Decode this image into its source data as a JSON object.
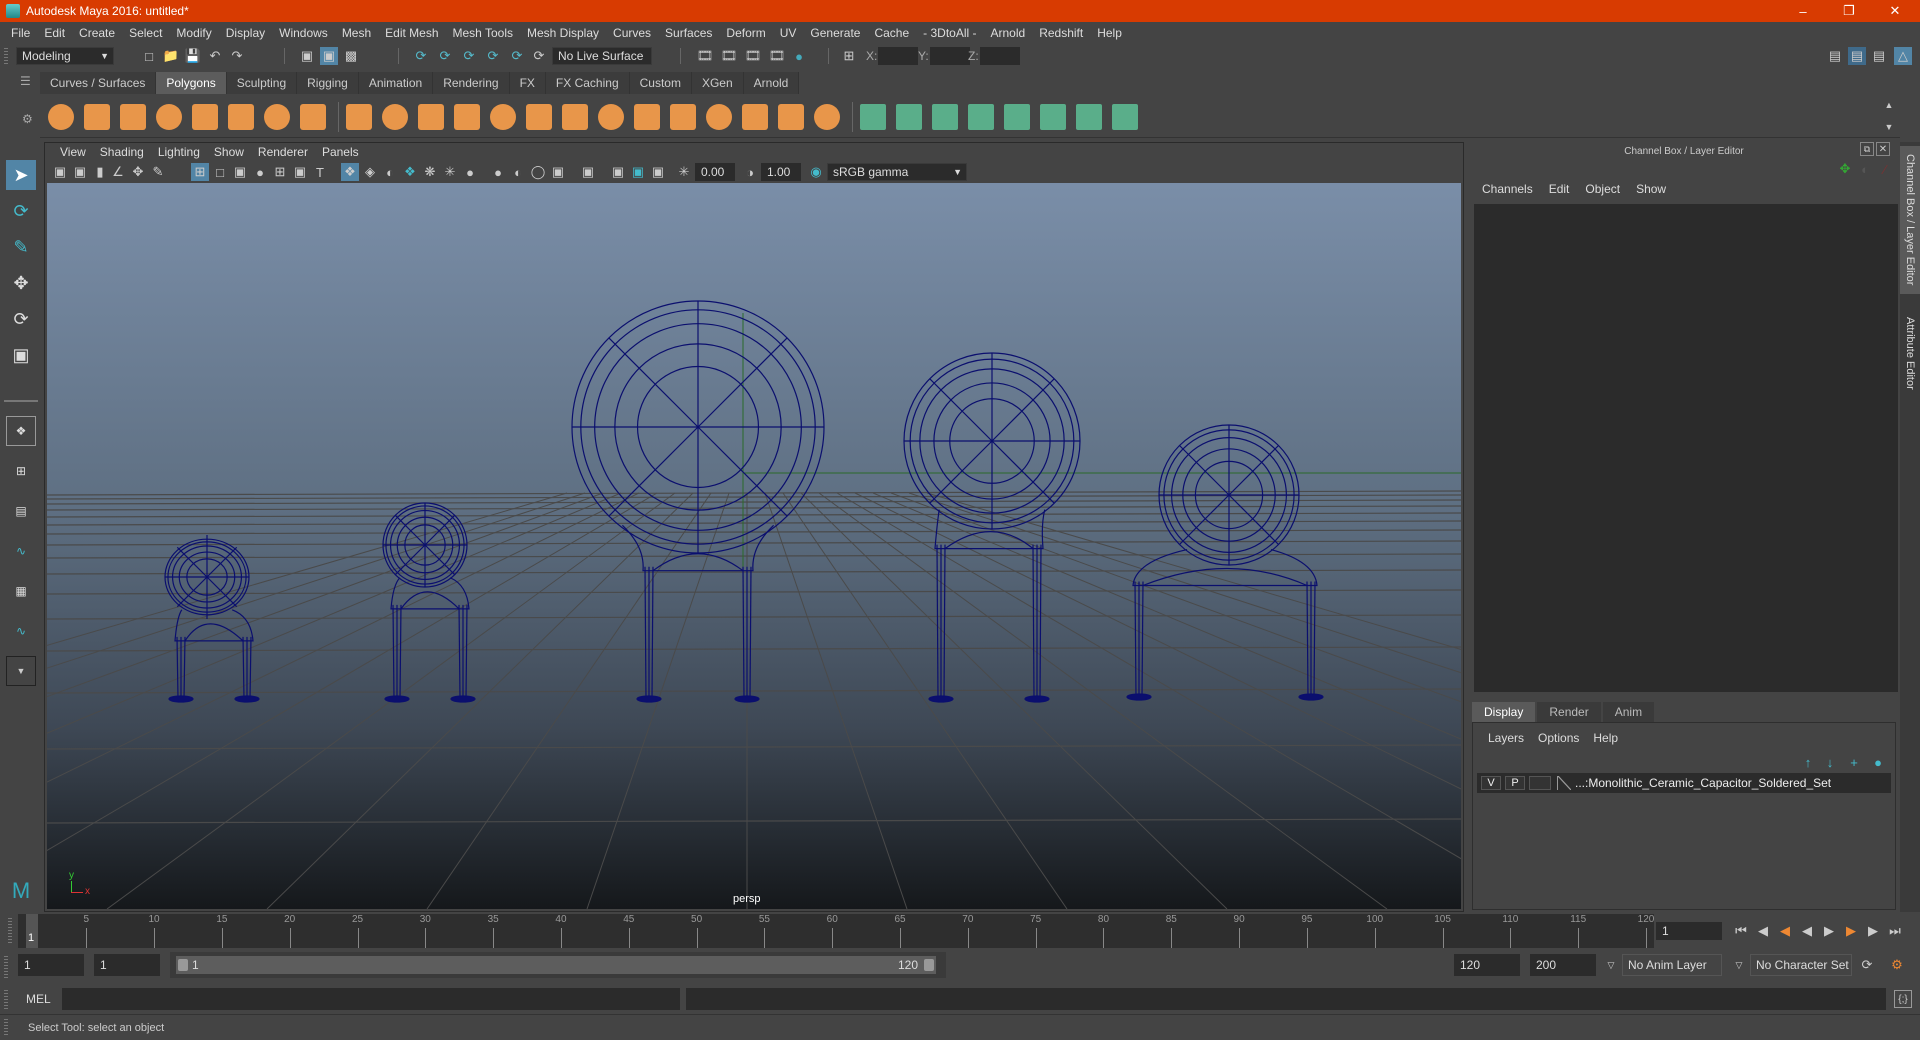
{
  "window": {
    "title": "Autodesk Maya 2016: untitled*",
    "controls": [
      "minimize",
      "restore",
      "close"
    ]
  },
  "menubar": [
    "File",
    "Edit",
    "Create",
    "Select",
    "Modify",
    "Display",
    "Windows",
    "Mesh",
    "Edit Mesh",
    "Mesh Tools",
    "Mesh Display",
    "Curves",
    "Surfaces",
    "Deform",
    "UV",
    "Generate",
    "Cache",
    "- 3DtoAll -",
    "Arnold",
    "Redshift",
    "Help"
  ],
  "statusline": {
    "mode": "Modeling",
    "live_surface": "No Live Surface",
    "x_label": "X:",
    "y_label": "Y:",
    "z_label": "Z:",
    "x_value": "",
    "y_value": "",
    "z_value": ""
  },
  "shelf": {
    "tabs": [
      "Curves / Surfaces",
      "Polygons",
      "Sculpting",
      "Rigging",
      "Animation",
      "Rendering",
      "FX",
      "FX Caching",
      "Custom",
      "XGen",
      "Arnold"
    ],
    "active_tab": "Polygons",
    "icons": [
      "poly-sphere",
      "poly-cube",
      "poly-cylinder",
      "poly-cone",
      "poly-plane",
      "poly-torus",
      "poly-pyramid",
      "poly-pipe",
      "combine",
      "separate",
      "mirror",
      "smooth",
      "extract",
      "bridge",
      "bevel",
      "extrude",
      "multi-cut",
      "target-weld",
      "insert-edge-loop",
      "offset-edge-loop",
      "append-polygon",
      "quad-draw",
      "fill-hole",
      "uv-planar",
      "uv-cylindrical",
      "uv-spherical",
      "uv-automatic",
      "uv-contour",
      "uv-editor",
      "uv-unfold"
    ]
  },
  "viewport": {
    "menu": [
      "View",
      "Shading",
      "Lighting",
      "Show",
      "Renderer",
      "Panels"
    ],
    "exposure": "0.00",
    "gamma": "1.00",
    "color_space": "sRGB gamma",
    "camera_label": "persp",
    "axis_y": "y",
    "axis_x": "x",
    "wire_color": "#0b0f6e"
  },
  "channel_box": {
    "title": "Channel Box / Layer Editor",
    "menu": [
      "Channels",
      "Edit",
      "Object",
      "Show"
    ]
  },
  "layer_editor": {
    "tabs": [
      "Display",
      "Render",
      "Anim"
    ],
    "active_tab": "Display",
    "menu": [
      "Layers",
      "Options",
      "Help"
    ],
    "layers": [
      {
        "visible": "V",
        "playback": "P",
        "name": "...:Monolithic_Ceramic_Capacitor_Soldered_Set"
      }
    ]
  },
  "side_tabs": [
    "Channel Box / Layer Editor",
    "Attribute Editor"
  ],
  "timeline": {
    "start": 1,
    "end": 120,
    "labels": [
      5,
      10,
      15,
      20,
      25,
      30,
      35,
      40,
      45,
      50,
      55,
      60,
      65,
      70,
      75,
      80,
      85,
      90,
      95,
      100,
      105,
      110,
      115,
      120
    ],
    "current_frame_label": "1",
    "current_frame": "1"
  },
  "range": {
    "start_time": "1",
    "playback_start": "1",
    "slider_start": "1",
    "slider_end": "120",
    "playback_end": "120",
    "end_time": "200",
    "anim_layer": "No Anim Layer",
    "character_set": "No Character Set"
  },
  "command_line": {
    "language": "MEL",
    "input": "",
    "output": ""
  },
  "help_line": "Select Tool: select an object"
}
